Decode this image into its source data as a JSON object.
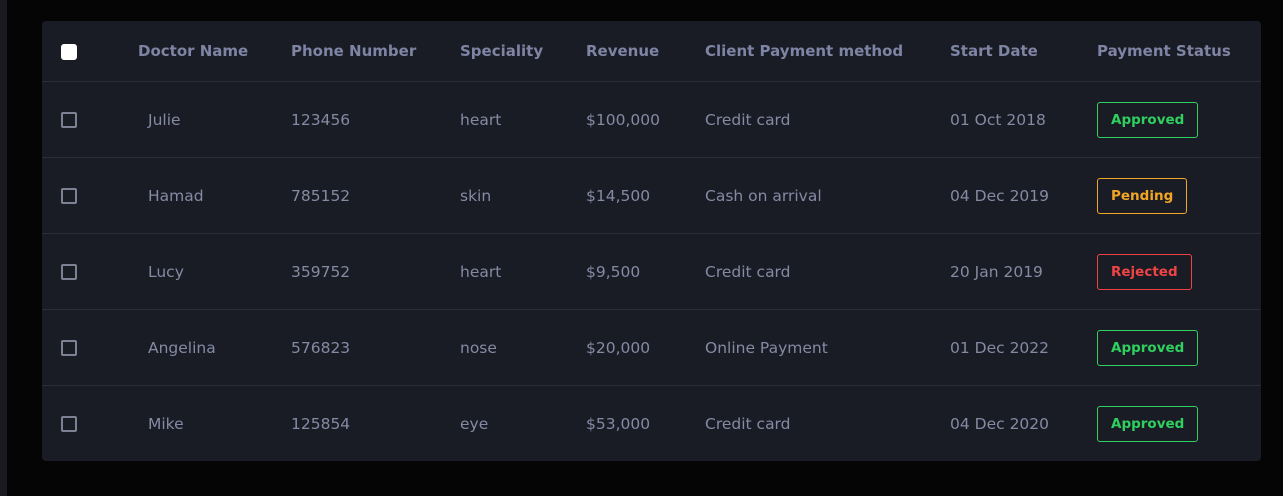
{
  "table": {
    "headers": {
      "doctor_name": "Doctor Name",
      "phone_number": "Phone Number",
      "speciality": "Speciality",
      "revenue": "Revenue",
      "payment_method": "Client Payment method",
      "start_date": "Start Date",
      "payment_status": "Payment Status"
    },
    "rows": [
      {
        "name": "Julie",
        "phone": "123456",
        "speciality": "heart",
        "revenue": "$100,000",
        "method": "Credit card",
        "start_date": "01 Oct 2018",
        "status": "Approved"
      },
      {
        "name": "Hamad",
        "phone": "785152",
        "speciality": "skin",
        "revenue": "$14,500",
        "method": "Cash on arrival",
        "start_date": "04 Dec 2019",
        "status": "Pending"
      },
      {
        "name": "Lucy",
        "phone": "359752",
        "speciality": "heart",
        "revenue": "$9,500",
        "method": "Credit card",
        "start_date": "20 Jan 2019",
        "status": "Rejected"
      },
      {
        "name": "Angelina",
        "phone": "576823",
        "speciality": "nose",
        "revenue": "$20,000",
        "method": "Online Payment",
        "start_date": "01 Dec 2022",
        "status": "Approved"
      },
      {
        "name": "Mike",
        "phone": "125854",
        "speciality": "eye",
        "revenue": "$53,000",
        "method": "Credit card",
        "start_date": "04 Dec 2020",
        "status": "Approved"
      }
    ]
  },
  "colors": {
    "background": "#050505",
    "card": "#1a1c25",
    "approved": "#2fd05f",
    "pending": "#f2a623",
    "rejected": "#ef4444"
  }
}
